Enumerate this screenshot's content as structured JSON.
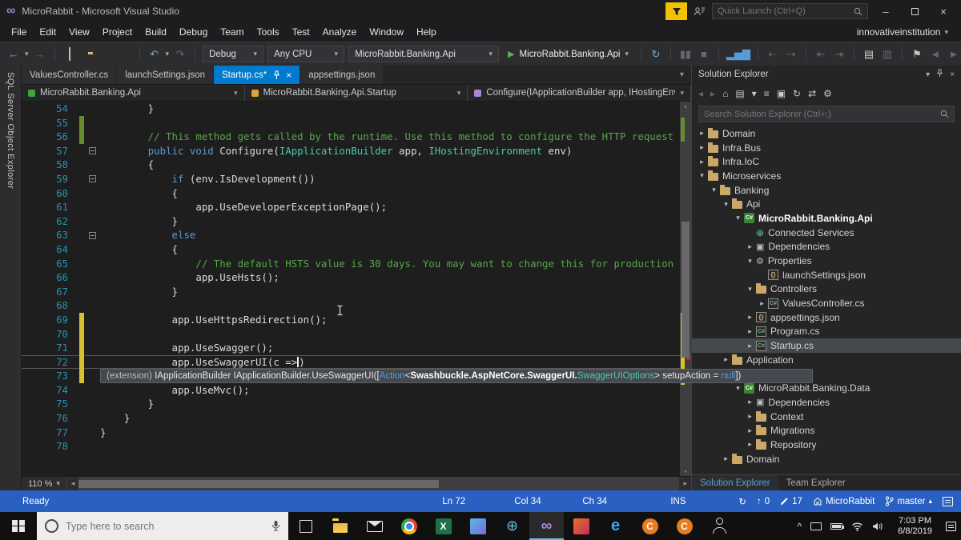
{
  "icons": {
    "chevron_down": "▾",
    "caret_up": "▴",
    "minimize": "–",
    "close": "×",
    "back_arrow": "←",
    "forward_arrow": "→",
    "undo": "↶",
    "redo": "↷",
    "play": "▶",
    "sync": "↻",
    "up_arrow": "↑",
    "hidden_icons": "^",
    "scroll_left": "◂",
    "scroll_right": "▸",
    "scroll_up": "▴",
    "scroll_down": "▾",
    "vs_logo": "∞"
  },
  "title_bar": {
    "title": "MicroRabbit - Microsoft Visual Studio",
    "quick_launch_placeholder": "Quick Launch (Ctrl+Q)"
  },
  "menu_bar": {
    "items": [
      "File",
      "Edit",
      "View",
      "Project",
      "Build",
      "Debug",
      "Team",
      "Tools",
      "Test",
      "Analyze",
      "Window",
      "Help"
    ],
    "account": "innovativeinstitution"
  },
  "toolbar": {
    "configuration": "Debug",
    "platform": "Any CPU",
    "startup_project": "MicroRabbit.Banking.Api",
    "run_target": "MicroRabbit.Banking.Api",
    "editor_icons": [
      {
        "name": "restart-icon",
        "glyph": "↻",
        "color": "#6fa8dc"
      },
      {
        "sep": true
      },
      {
        "name": "break-all-icon",
        "glyph": "▮▮",
        "dim": true
      },
      {
        "name": "stop-icon",
        "glyph": "■",
        "dim": true
      },
      {
        "sep": true
      },
      {
        "name": "performance-chart-icon",
        "glyph": "▂▅▇",
        "color": "#569cd6"
      },
      {
        "sep": true
      },
      {
        "name": "navigate-backward-icon",
        "glyph": "⇠",
        "dim": true
      },
      {
        "name": "navigate-forward-icon",
        "glyph": "⇢",
        "dim": true
      },
      {
        "sep": true
      },
      {
        "name": "decrease-indent-icon",
        "glyph": "⇤",
        "dim": true
      },
      {
        "name": "increase-indent-icon",
        "glyph": "⇥",
        "dim": true
      },
      {
        "sep": true
      },
      {
        "name": "comment-icon",
        "glyph": "▤"
      },
      {
        "name": "uncomment-icon",
        "glyph": "▥",
        "dim": true
      },
      {
        "sep": true
      },
      {
        "name": "bookmark-icon",
        "glyph": "⚑"
      },
      {
        "name": "previous-bookmark-icon",
        "glyph": "◄",
        "dim": true
      },
      {
        "name": "next-bookmark-icon",
        "glyph": "►",
        "dim": true
      },
      {
        "name": "toolbar-overflow-chevron",
        "glyph": "▾",
        "dim": true
      }
    ]
  },
  "side_strip": {
    "label": "SQL Server Object Explorer"
  },
  "editor": {
    "tabs": [
      {
        "label": "ValuesController.cs",
        "active": false
      },
      {
        "label": "launchSettings.json",
        "active": false
      },
      {
        "label": "Startup.cs*",
        "active": true
      },
      {
        "label": "appsettings.json",
        "active": false
      }
    ],
    "breadcrumbs": [
      {
        "label": "MicroRabbit.Banking.Api",
        "icon_color": "#37a93c"
      },
      {
        "label": "MicroRabbit.Banking.Api.Startup",
        "icon_color": "#d9a33c"
      },
      {
        "label": "Configure(IApplicationBuilder app, IHostingEnvir",
        "icon_color": "#b180d7"
      }
    ],
    "zoom_level": "110 %",
    "code_lines": [
      {
        "num": 54,
        "tokens": [
          [
            "pl",
            "        }"
          ]
        ]
      },
      {
        "num": 55,
        "marker": "green",
        "tokens": []
      },
      {
        "num": 56,
        "marker": "green",
        "tokens": [
          [
            "cm",
            "        // This method gets called by the runtime. Use this method to configure the HTTP request"
          ]
        ]
      },
      {
        "num": 57,
        "fold": true,
        "tokens": [
          [
            "pl",
            "        "
          ],
          [
            "kw",
            "public"
          ],
          [
            "pl",
            " "
          ],
          [
            "kw",
            "void"
          ],
          [
            "pl",
            " Configure("
          ],
          [
            "ty",
            "IApplicationBuilder"
          ],
          [
            "pl",
            " app, "
          ],
          [
            "ty",
            "IHostingEnvironment"
          ],
          [
            "pl",
            " env)"
          ]
        ]
      },
      {
        "num": 58,
        "tokens": [
          [
            "pl",
            "        {"
          ]
        ]
      },
      {
        "num": 59,
        "fold": true,
        "tokens": [
          [
            "pl",
            "            "
          ],
          [
            "kw",
            "if"
          ],
          [
            "pl",
            " (env.IsDevelopment())"
          ]
        ]
      },
      {
        "num": 60,
        "tokens": [
          [
            "pl",
            "            {"
          ]
        ]
      },
      {
        "num": 61,
        "tokens": [
          [
            "pl",
            "                app.UseDeveloperExceptionPage();"
          ]
        ]
      },
      {
        "num": 62,
        "tokens": [
          [
            "pl",
            "            }"
          ]
        ]
      },
      {
        "num": 63,
        "fold": true,
        "tokens": [
          [
            "pl",
            "            "
          ],
          [
            "kw",
            "else"
          ]
        ]
      },
      {
        "num": 64,
        "tokens": [
          [
            "pl",
            "            {"
          ]
        ]
      },
      {
        "num": 65,
        "tokens": [
          [
            "cm",
            "                // The default HSTS value is 30 days. You may want to change this for production"
          ]
        ]
      },
      {
        "num": 66,
        "tokens": [
          [
            "pl",
            "                app.UseHsts();"
          ]
        ]
      },
      {
        "num": 67,
        "tokens": [
          [
            "pl",
            "            }"
          ]
        ]
      },
      {
        "num": 68,
        "tokens": []
      },
      {
        "num": 69,
        "marker": "yellow",
        "tokens": [
          [
            "pl",
            "            app.UseHttpsRedirection();"
          ]
        ]
      },
      {
        "num": 70,
        "marker": "yellow",
        "tokens": []
      },
      {
        "num": 71,
        "marker": "yellow",
        "tokens": [
          [
            "pl",
            "            app.UseSwagger();"
          ]
        ]
      },
      {
        "num": 72,
        "marker": "yellow",
        "current": true,
        "tokens": [
          [
            "pl",
            "            app.UseSwaggerUI(c =>"
          ],
          [
            "caret",
            ""
          ],
          [
            "pl",
            ")"
          ]
        ]
      },
      {
        "num": 73,
        "marker": "yellow",
        "tokens": []
      },
      {
        "num": 74,
        "tokens": [
          [
            "pl",
            "            app.UseMvc();"
          ]
        ]
      },
      {
        "num": 75,
        "tokens": [
          [
            "pl",
            "        }"
          ]
        ]
      },
      {
        "num": 76,
        "tokens": [
          [
            "pl",
            "    }"
          ]
        ]
      },
      {
        "num": 77,
        "tokens": [
          [
            "pl",
            "}"
          ]
        ]
      },
      {
        "num": 78,
        "tokens": []
      }
    ]
  },
  "signature_tooltip": {
    "parts": [
      [
        "mut",
        "(extension)"
      ],
      [
        "pl",
        " IApplicationBuilder IApplicationBuilder.UseSwaggerUI(["
      ],
      [
        "kw",
        "Action"
      ],
      [
        "pl",
        "<"
      ],
      [
        "b",
        "Swashbuckle.AspNetCore.SwaggerUI."
      ],
      [
        "ty",
        "SwaggerUIOptions"
      ],
      [
        "pl",
        "> setupAction = "
      ],
      [
        "kw",
        "null"
      ],
      [
        "pl",
        "])"
      ]
    ]
  },
  "solution_explorer": {
    "title": "Solution Explorer",
    "search_placeholder": "Search Solution Explorer (Ctrl+;)",
    "toolbar_icons": [
      {
        "name": "back-icon",
        "glyph": "◂",
        "dim": true
      },
      {
        "name": "forward-icon",
        "glyph": "▸",
        "dim": true
      },
      {
        "name": "home-icon",
        "glyph": "⌂"
      },
      {
        "name": "switch-views-icon",
        "glyph": "▤"
      },
      {
        "name": "filter-dropdown-icon",
        "glyph": "▾"
      },
      {
        "name": "collapse-all-icon",
        "glyph": "≡"
      },
      {
        "name": "show-all-files-icon",
        "glyph": "▣"
      },
      {
        "name": "refresh-icon",
        "glyph": "↻"
      },
      {
        "name": "sync-active-document-icon",
        "glyph": "⇄"
      },
      {
        "name": "properties-icon",
        "glyph": "⚙"
      }
    ],
    "tree": [
      {
        "label": "Domain",
        "level": 0,
        "exp": "c",
        "icon": "folder"
      },
      {
        "label": "Infra.Bus",
        "level": 0,
        "exp": "c",
        "icon": "folder"
      },
      {
        "label": "Infra.IoC",
        "level": 0,
        "exp": "c",
        "icon": "folder"
      },
      {
        "label": "Microservices",
        "level": 0,
        "exp": "e",
        "icon": "folder"
      },
      {
        "label": "Banking",
        "level": 1,
        "exp": "e",
        "icon": "folder"
      },
      {
        "label": "Api",
        "level": 2,
        "exp": "e",
        "icon": "folder"
      },
      {
        "label": "MicroRabbit.Banking.Api",
        "level": 3,
        "exp": "e",
        "icon": "proj",
        "bold": true
      },
      {
        "label": "Connected Services",
        "level": 4,
        "exp": null,
        "icon": "globe"
      },
      {
        "label": "Dependencies",
        "level": 4,
        "exp": "c",
        "icon": "pkg"
      },
      {
        "label": "Properties",
        "level": 4,
        "exp": "e",
        "icon": "cog"
      },
      {
        "label": "launchSettings.json",
        "level": 5,
        "exp": null,
        "icon": "json"
      },
      {
        "label": "Controllers",
        "level": 4,
        "exp": "e",
        "icon": "folder"
      },
      {
        "label": "ValuesController.cs",
        "level": 5,
        "exp": "c",
        "icon": "cs"
      },
      {
        "label": "appsettings.json",
        "level": 4,
        "exp": "c",
        "icon": "json"
      },
      {
        "label": "Program.cs",
        "level": 4,
        "exp": "c",
        "icon": "cs"
      },
      {
        "label": "Startup.cs",
        "level": 4,
        "exp": "c",
        "icon": "cs",
        "selected": true
      },
      {
        "label": "Application",
        "level": 2,
        "exp": "c",
        "icon": "folder"
      },
      {
        "label": "",
        "level": 2,
        "exp": null,
        "icon": null,
        "obscured": true
      },
      {
        "label": "MicroRabbit.Banking.Data",
        "level": 3,
        "exp": "e",
        "icon": "proj"
      },
      {
        "label": "Dependencies",
        "level": 4,
        "exp": "c",
        "icon": "pkg"
      },
      {
        "label": "Context",
        "level": 4,
        "exp": "c",
        "icon": "folder"
      },
      {
        "label": "Migrations",
        "level": 4,
        "exp": "c",
        "icon": "folder"
      },
      {
        "label": "Repository",
        "level": 4,
        "exp": "c",
        "icon": "folder"
      },
      {
        "label": "Domain",
        "level": 2,
        "exp": "c",
        "icon": "folder"
      }
    ],
    "bottom_tabs": [
      {
        "label": "Solution Explorer",
        "active": true
      },
      {
        "label": "Team Explorer",
        "active": false
      }
    ]
  },
  "status_bar": {
    "message": "Ready",
    "line": "Ln 72",
    "column": "Col 34",
    "character": "Ch 34",
    "mode": "INS",
    "pushes": "0",
    "pending_edits": "17",
    "repository": "MicroRabbit",
    "branch": "master"
  },
  "taskbar": {
    "search_placeholder": "Type here to search",
    "time": "7:03 PM",
    "date": "6/8/2019",
    "apps": [
      {
        "name": "task-view-button",
        "kind": "taskview"
      },
      {
        "name": "file-explorer-icon",
        "kind": "folder"
      },
      {
        "name": "mail-icon",
        "kind": "mail"
      },
      {
        "name": "chrome-icon",
        "kind": "chrome"
      },
      {
        "name": "excel-icon",
        "kind": "tile",
        "glyph": "X",
        "bg": "#1e7145",
        "color": "#ffffff"
      },
      {
        "name": "store-app-icon",
        "kind": "tile",
        "glyph": "",
        "bg": "linear-gradient(135deg,#58b7e6,#7a6ae0)"
      },
      {
        "name": "internet-globe-icon",
        "kind": "glyph",
        "glyph": "⊕",
        "color": "#6cb6e4",
        "size": 18
      },
      {
        "name": "visual-studio-icon",
        "kind": "glyph",
        "glyph": "∞",
        "color": "#b287e0",
        "size": 19,
        "bold": true,
        "active": true
      },
      {
        "name": "mixed-reality-viewer-icon",
        "kind": "tile",
        "glyph": "",
        "bg": "linear-gradient(135deg,#e8702b,#c22f55)"
      },
      {
        "name": "edge-icon",
        "kind": "glyph",
        "glyph": "e",
        "color": "#38a9e8",
        "size": 20,
        "bold": true
      },
      {
        "name": "c-app-icon-1",
        "kind": "tile",
        "glyph": "C",
        "bg": "#e87c1e",
        "color": "#ffffff",
        "round": true
      },
      {
        "name": "c-app-icon-2",
        "kind": "tile",
        "glyph": "C",
        "bg": "#e87c1e",
        "color": "#ffffff",
        "round": true
      },
      {
        "name": "people-icon",
        "kind": "people"
      }
    ]
  }
}
